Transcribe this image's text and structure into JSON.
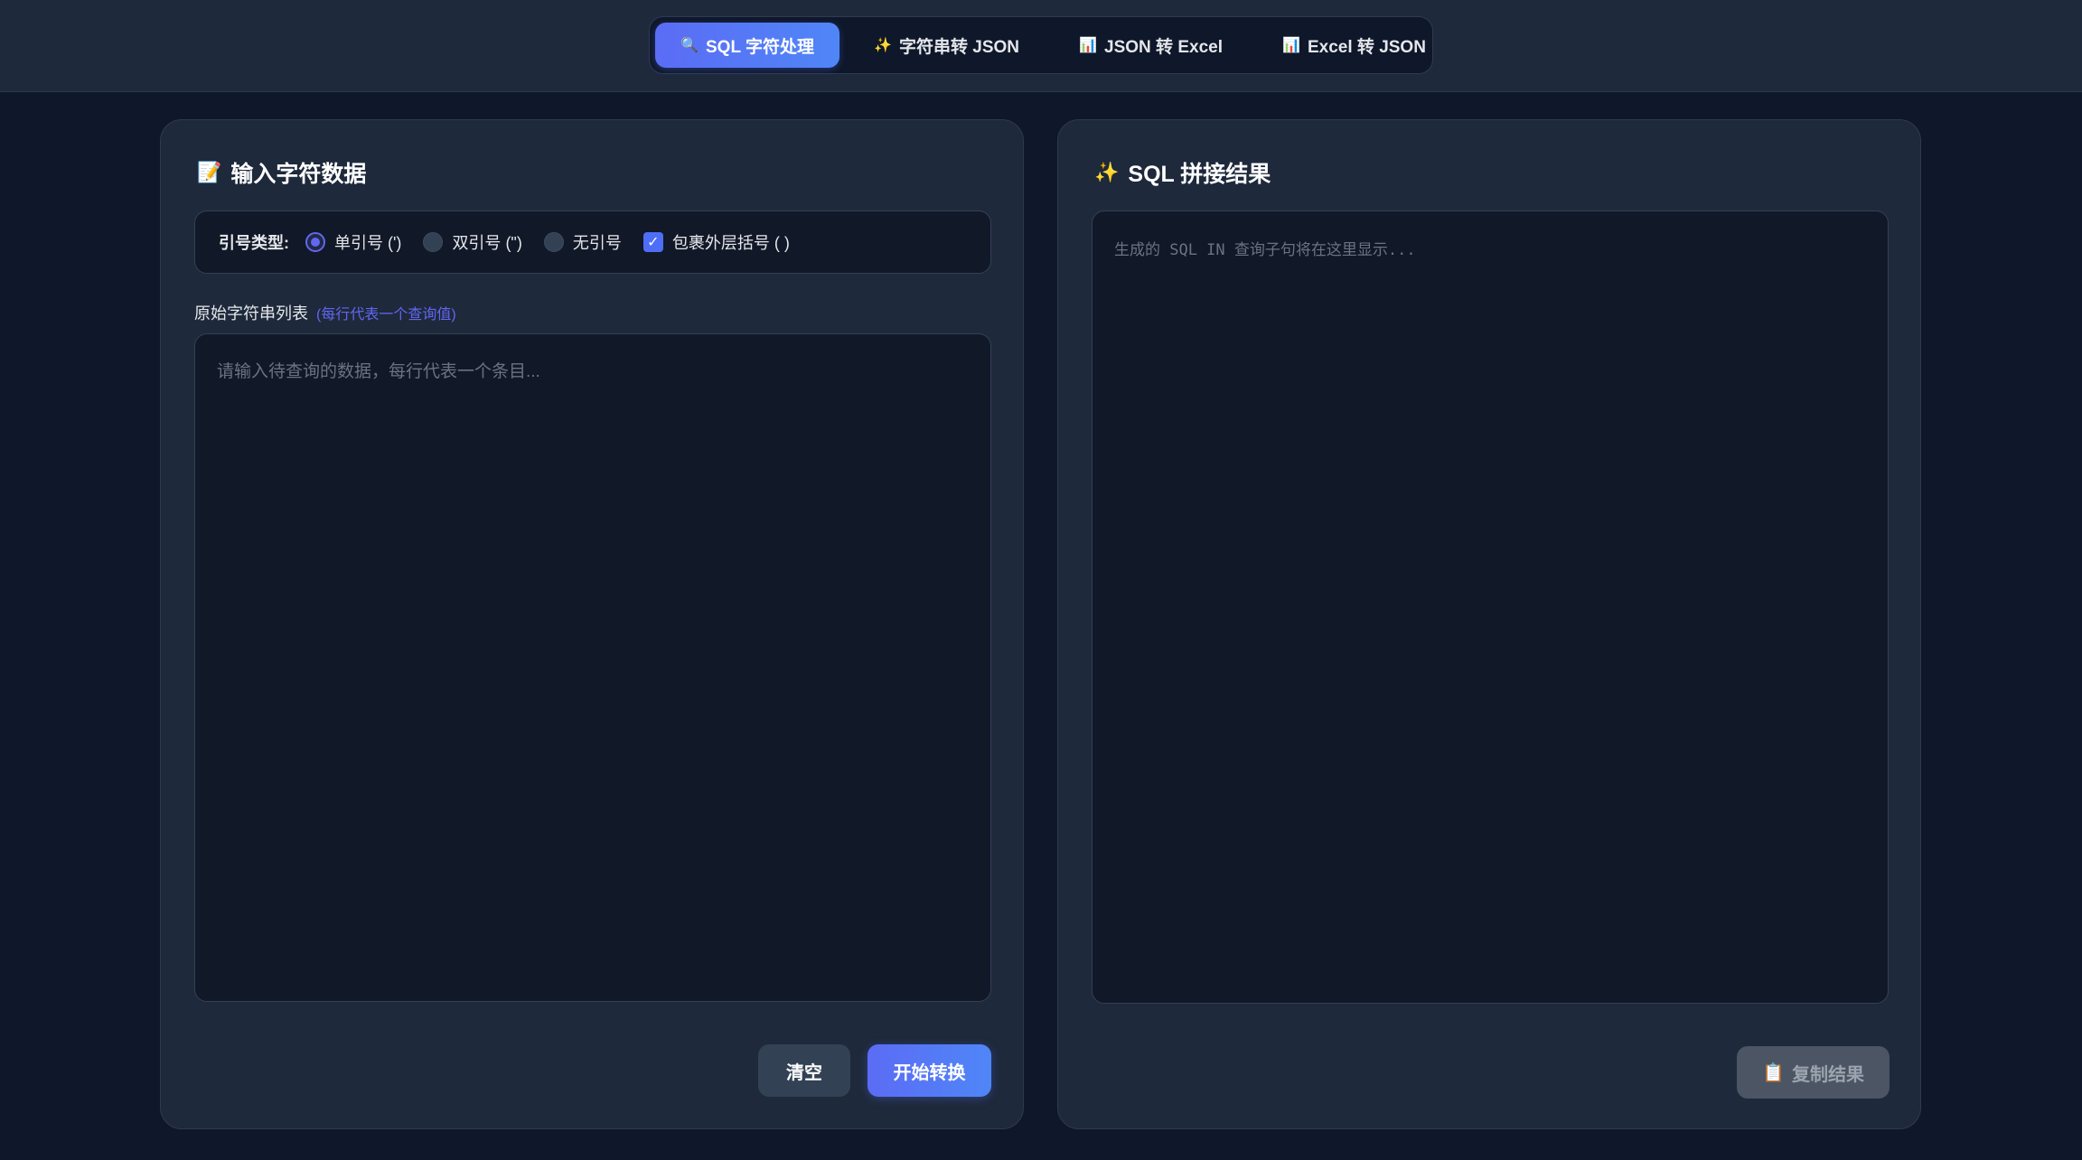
{
  "nav": {
    "tabs": [
      {
        "icon": "magnifier-icon",
        "glyph": "🔍",
        "label": "SQL 字符处理",
        "active": true
      },
      {
        "icon": "sparkles-icon",
        "glyph": "✨",
        "label": "字符串转 JSON",
        "active": false
      },
      {
        "icon": "bar-chart-icon",
        "glyph": "📊",
        "label": "JSON 转 Excel",
        "active": false
      },
      {
        "icon": "bar-chart-icon",
        "glyph": "📊",
        "label": "Excel 转 JSON",
        "active": false
      }
    ]
  },
  "input_panel": {
    "title_glyph": "📝",
    "title": "输入字符数据",
    "quote_label": "引号类型:",
    "options": {
      "single": "单引号 (')",
      "double": "双引号 (\")",
      "none": "无引号",
      "wrap": "包裹外层括号 ( )"
    },
    "field_label": "原始字符串列表",
    "field_hint": "(每行代表一个查询值)",
    "placeholder": "请输入待查询的数据，每行代表一个条目...",
    "clear_label": "清空",
    "start_label": "开始转换"
  },
  "result_panel": {
    "title_glyph": "✨",
    "title": "SQL 拼接结果",
    "placeholder": "生成的 SQL IN 查询子句将在这里显示...",
    "copy_glyph": "📋",
    "copy_label": "复制结果"
  },
  "colors": {
    "accent": "#4f6ef7",
    "background": "#0f172a",
    "panel": "#1e293b"
  }
}
